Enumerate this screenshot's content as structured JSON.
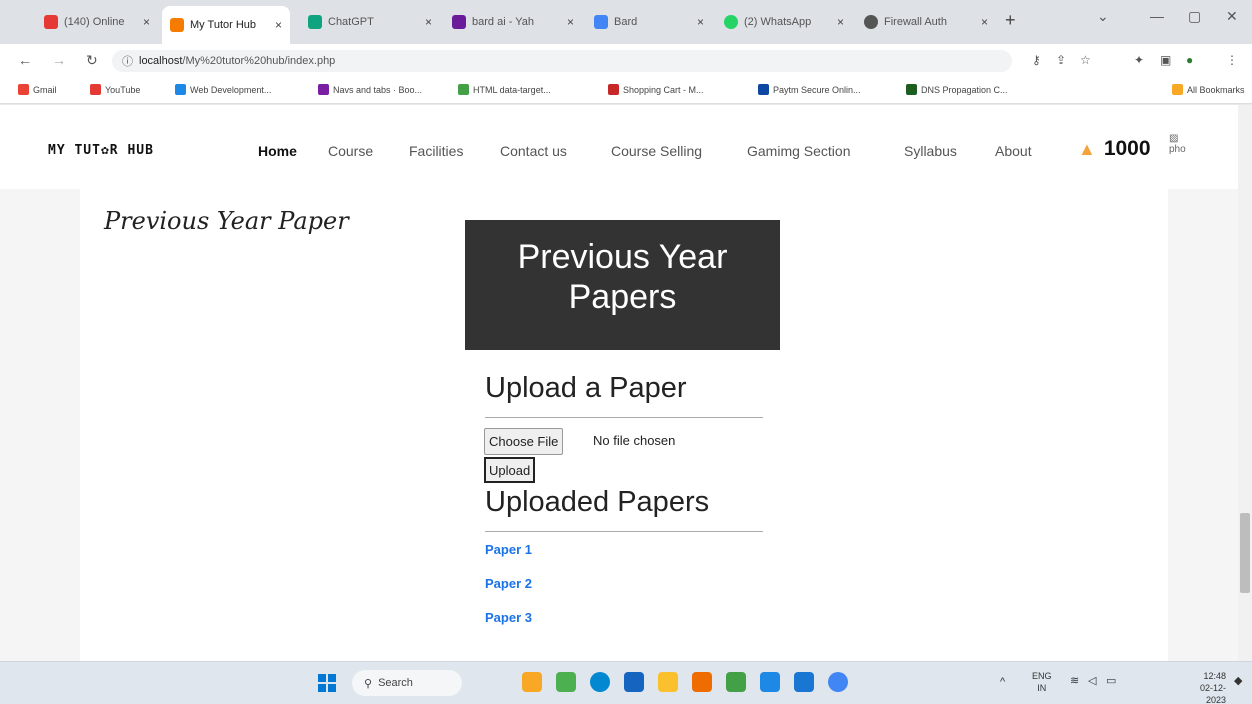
{
  "browser": {
    "tabs": [
      {
        "label": "(140) Online",
        "color": "#e53935"
      },
      {
        "label": "My Tutor Hub",
        "color": "#f57c00",
        "active": true
      },
      {
        "label": "ChatGPT",
        "color": "#10a37f"
      },
      {
        "label": "bard ai - Yah",
        "color": "#6a1b9a"
      },
      {
        "label": "Bard",
        "color": "#4285f4"
      },
      {
        "label": "(2) WhatsApp",
        "color": "#25d366"
      },
      {
        "label": "Firewall Auth",
        "color": "#555555"
      }
    ],
    "tab_close": "×",
    "new_tab": "+",
    "url_host": "localhost",
    "url_path": "/My%20tutor%20hub/index.php",
    "bookmarks": [
      {
        "label": "Gmail",
        "color": "#ea4335"
      },
      {
        "label": "YouTube",
        "color": "#e53935"
      },
      {
        "label": "Web Development...",
        "color": "#1e88e5"
      },
      {
        "label": "Navs and tabs · Boo...",
        "color": "#7b1fa2"
      },
      {
        "label": "HTML data-target...",
        "color": "#43a047"
      },
      {
        "label": "Shopping Cart - M...",
        "color": "#c62828"
      },
      {
        "label": "Paytm Secure Onlin...",
        "color": "#0d47a1"
      },
      {
        "label": "DNS Propagation C...",
        "color": "#1b5e20"
      }
    ],
    "all_bookmarks": "All Bookmarks"
  },
  "site": {
    "logo": "MY TUT✿R HUB",
    "nav": [
      "Home",
      "Course",
      "Facilities",
      "Contact us",
      "Course Selling",
      "Gamimg Section",
      "Syllabus",
      "About"
    ],
    "coins": "1000",
    "avatar_alt": "pho"
  },
  "page": {
    "side_title": "Previous Year Paper",
    "hero_title": "Previous Year Papers",
    "upload_heading": "Upload a Paper",
    "choose_file": "Choose File",
    "no_file": "No file chosen",
    "upload_button": "Upload",
    "uploaded_heading": "Uploaded Papers",
    "papers": [
      "Paper 1",
      "Paper 2",
      "Paper 3"
    ]
  },
  "taskbar": {
    "search": "Search",
    "lang_top": "ENG",
    "lang_bottom": "IN",
    "time": "12:48",
    "date": "02-12-2023"
  }
}
